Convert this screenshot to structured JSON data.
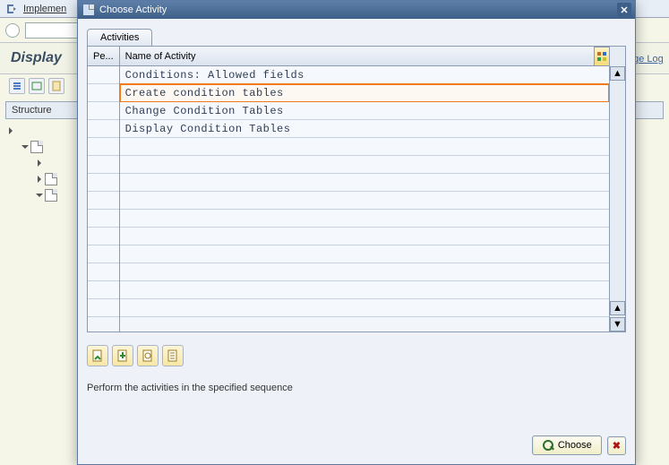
{
  "topbar": {
    "link": "Implemen"
  },
  "panel": {
    "title": "Display"
  },
  "sidebar": {
    "header": "Structure"
  },
  "dialog": {
    "title": "Choose Activity",
    "tab": "Activities",
    "col_left": "Pe...",
    "col_main": "Name of Activity",
    "rows": [
      "Conditions: Allowed fields",
      "Create condition tables",
      "Change Condition Tables",
      "Display Condition Tables"
    ],
    "hint": "Perform the activities in the specified sequence",
    "choose": "Choose"
  },
  "visible": {
    "change_log": "nge Log"
  }
}
